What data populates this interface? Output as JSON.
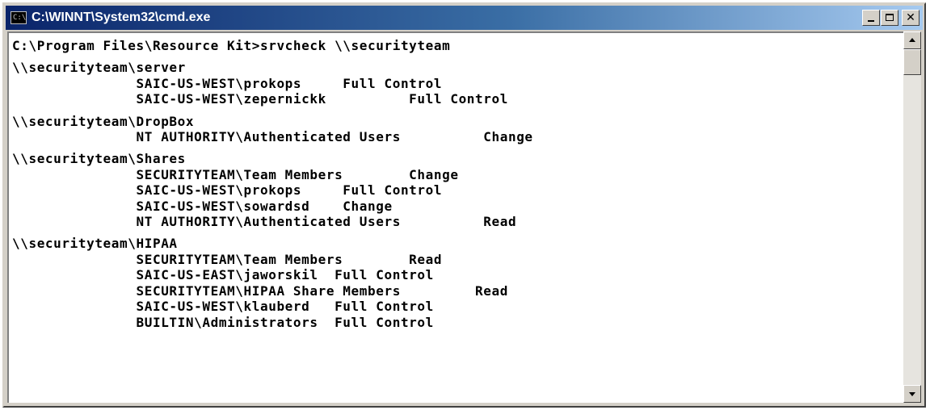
{
  "window": {
    "title": "C:\\WINNT\\System32\\cmd.exe"
  },
  "console": {
    "prompt_line": "C:\\Program Files\\Resource Kit>srvcheck \\\\securityteam",
    "blocks": [
      {
        "header": "\\\\securityteam\\server",
        "lines": [
          "               SAIC-US-WEST\\prokops     Full Control",
          "               SAIC-US-WEST\\zepernickk          Full Control"
        ]
      },
      {
        "header": "\\\\securityteam\\DropBox",
        "lines": [
          "               NT AUTHORITY\\Authenticated Users          Change"
        ]
      },
      {
        "header": "\\\\securityteam\\Shares",
        "lines": [
          "               SECURITYTEAM\\Team Members        Change",
          "               SAIC-US-WEST\\prokops     Full Control",
          "               SAIC-US-WEST\\sowardsd    Change",
          "               NT AUTHORITY\\Authenticated Users          Read"
        ]
      },
      {
        "header": "\\\\securityteam\\HIPAA",
        "lines": [
          "               SECURITYTEAM\\Team Members        Read",
          "               SAIC-US-EAST\\jaworskil  Full Control",
          "               SECURITYTEAM\\HIPAA Share Members         Read",
          "               SAIC-US-WEST\\klauberd   Full Control",
          "               BUILTIN\\Administrators  Full Control"
        ]
      }
    ]
  },
  "icons": {
    "window_icon": "cmd-console-icon",
    "minimize": "minimize-icon",
    "maximize": "maximize-icon",
    "close": "close-icon",
    "scroll_up": "scroll-up-arrow-icon",
    "scroll_down": "scroll-down-arrow-icon"
  },
  "colors": {
    "title_bar_start": "#0a246a",
    "title_bar_end": "#a6caf0",
    "console_background": "#ffffff",
    "console_text": "#000000"
  }
}
